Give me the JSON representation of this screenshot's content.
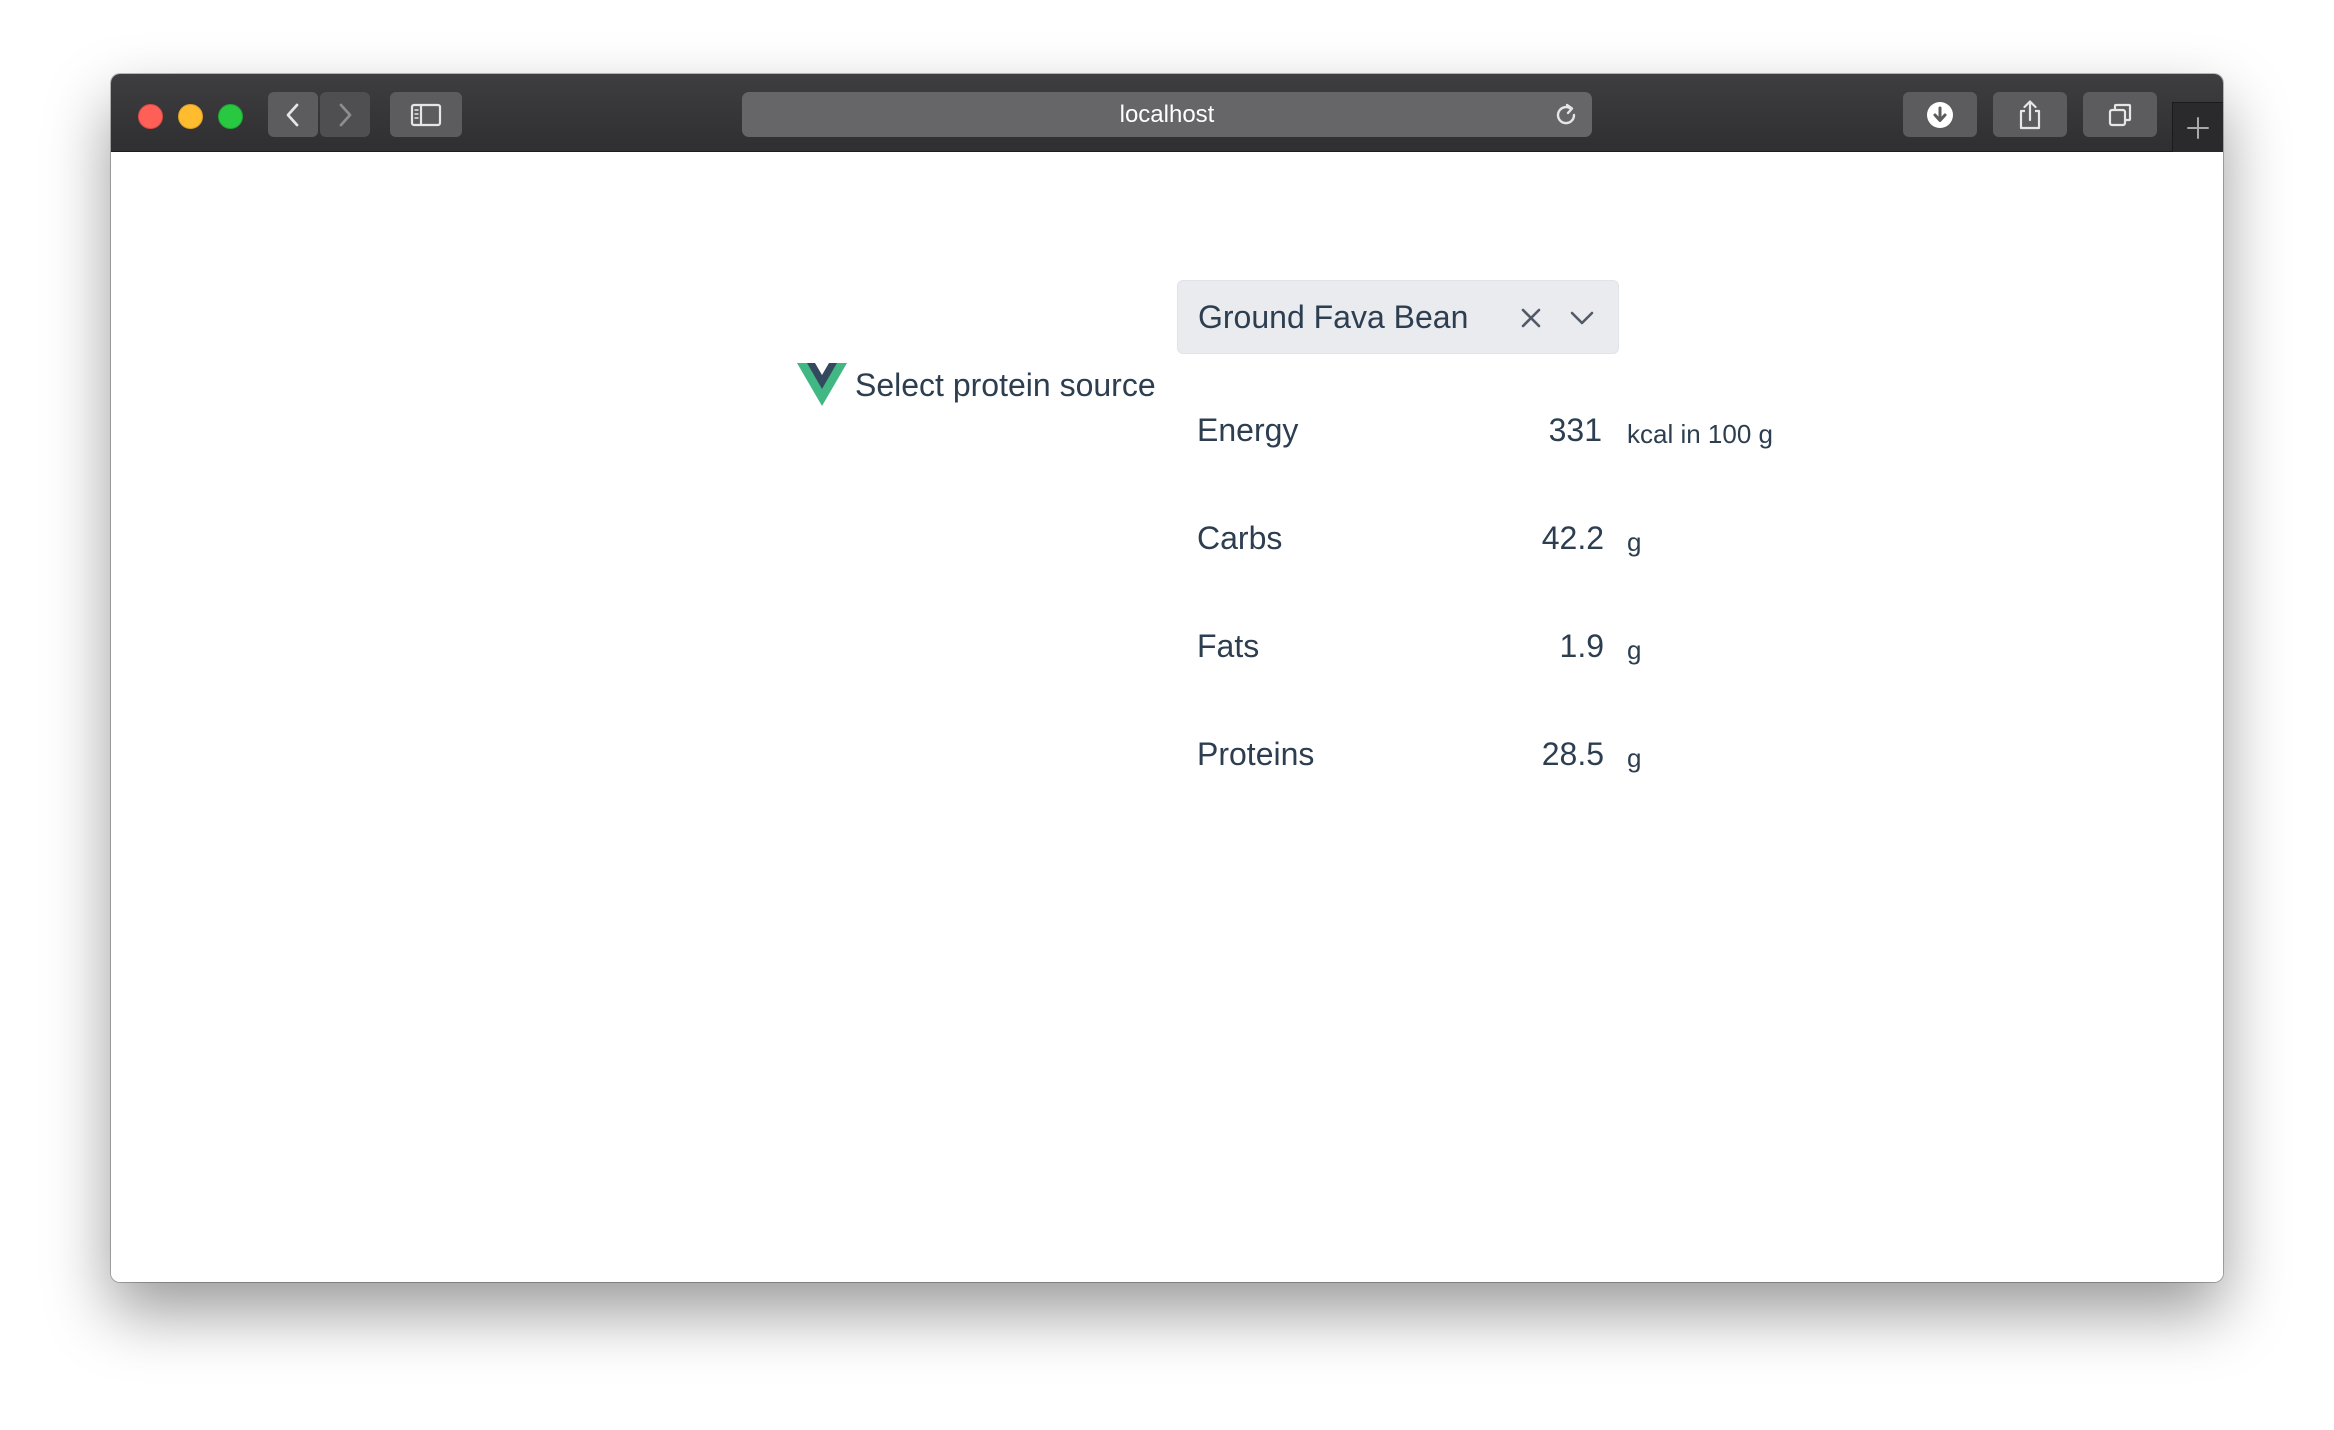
{
  "browser": {
    "url": "localhost",
    "icons": {
      "back": "chevron-left-icon",
      "forward": "chevron-right-icon",
      "sidebar": "sidebar-icon",
      "reload": "reload-icon",
      "download": "download-icon",
      "share": "share-icon",
      "tabs": "tabs-icon",
      "new_tab": "plus-icon"
    }
  },
  "page": {
    "select_label": "Select protein source",
    "selected_value": "Ground Fava Bean",
    "accent_colors": {
      "vue_green": "#41b883",
      "vue_dark": "#35495e",
      "text": "#2c3e50"
    }
  },
  "nutrients": [
    {
      "name": "Energy",
      "value": "331",
      "unit": "kcal in 100 g"
    },
    {
      "name": "Carbs",
      "value": "42.2",
      "unit": "g"
    },
    {
      "name": "Fats",
      "value": "1.9",
      "unit": "g"
    },
    {
      "name": "Proteins",
      "value": "28.5",
      "unit": "g"
    }
  ]
}
